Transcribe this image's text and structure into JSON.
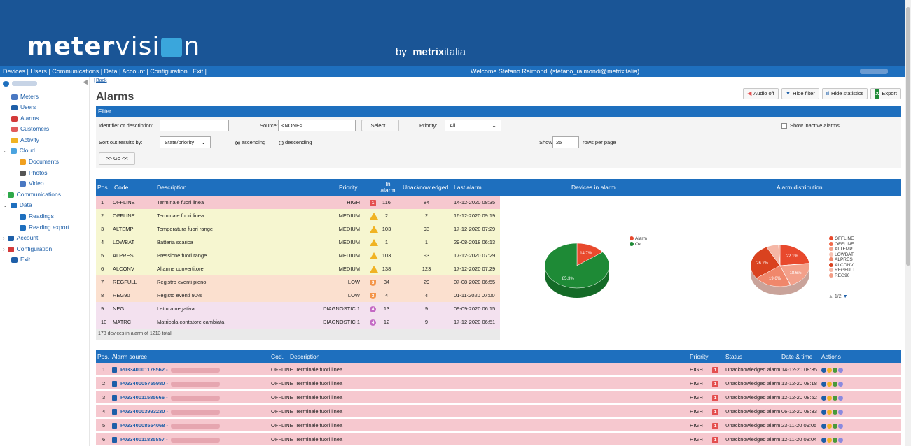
{
  "header": {
    "logo_main": "meter",
    "logo_thin": "visi",
    "logo_end": "n",
    "by_text": "by",
    "brand_bold": "metrix",
    "brand_light": "italia"
  },
  "nav": {
    "links": "Devices | Users | Communications | Data | Account | Configuration | Exit |",
    "welcome": "Welcome Stefano Raimondi (stefano_raimondi@metrixitalia)"
  },
  "sidebar": {
    "items": [
      {
        "label": "Meters",
        "color": "#4a78c2"
      },
      {
        "label": "Users",
        "color": "#1e5fa8"
      },
      {
        "label": "Alarms",
        "color": "#d33a3a"
      },
      {
        "label": "Customers",
        "color": "#e25c5c"
      },
      {
        "label": "Activity",
        "color": "#f0b323"
      },
      {
        "label": "Cloud",
        "color": "#4aa3df"
      },
      {
        "label": "Documents",
        "color": "#f0a020"
      },
      {
        "label": "Photos",
        "color": "#555"
      },
      {
        "label": "Video",
        "color": "#4a78c2"
      },
      {
        "label": "Communications",
        "color": "#2ea84a"
      },
      {
        "label": "Data",
        "color": "#1e6fbe"
      },
      {
        "label": "Readings",
        "color": "#1e6fbe"
      },
      {
        "label": "Reading export",
        "color": "#1e6fbe"
      },
      {
        "label": "Account",
        "color": "#1e5fa8"
      },
      {
        "label": "Configuration",
        "color": "#d33a3a"
      },
      {
        "label": "Exit",
        "color": "#1e5fa8"
      }
    ]
  },
  "page": {
    "back": "Back",
    "title": "Alarms",
    "buttons": {
      "audio_off": "Audio off",
      "hide_filter": "Hide filter",
      "hide_statistics": "Hide statistics",
      "export": "Export"
    }
  },
  "filter": {
    "heading": "Filter",
    "identifier_label": "Identifier or description:",
    "identifier_value": "",
    "source_label": "Source:",
    "source_value": "<NONE>",
    "select_button": "Select...",
    "priority_label": "Priority:",
    "priority_value": "All",
    "show_inactive": "Show inactive alarms",
    "sort_label": "Sort out results by:",
    "sort_value": "State/priority",
    "ascending": "ascending",
    "descending": "descending",
    "show_label": "Show",
    "rows_value": "25",
    "rows_suffix": "rows per page",
    "go_button": ">> Go <<"
  },
  "alarms_table": {
    "headers": {
      "pos": "Pos.",
      "code": "Code",
      "description": "Description",
      "priority": "Priority",
      "in_alarm_1": "In",
      "in_alarm_2": "alarm",
      "unacknowledged": "Unacknowledged",
      "last_alarm": "Last alarm",
      "devices_in_alarm": "Devices in alarm",
      "alarm_distribution": "Alarm distribution"
    },
    "rows": [
      {
        "pos": "1",
        "code": "OFFLINE",
        "desc": "Terminale fuori linea",
        "priority": "HIGH",
        "level": "high",
        "icon": "1",
        "in_alarm": "116",
        "unack": "84",
        "last": "14-12-2020 08:35",
        "bg": "#f6c8cf"
      },
      {
        "pos": "2",
        "code": "OFFLINE",
        "desc": "Terminale fuori linea",
        "priority": "MEDIUM",
        "level": "medium",
        "icon": "",
        "in_alarm": "2",
        "unack": "2",
        "last": "16-12-2020 09:19",
        "bg": "#f6f6d0"
      },
      {
        "pos": "3",
        "code": "ALTEMP",
        "desc": "Temperatura fuori range",
        "priority": "MEDIUM",
        "level": "medium",
        "icon": "",
        "in_alarm": "103",
        "unack": "93",
        "last": "17-12-2020 07:29",
        "bg": "#f6f6d0"
      },
      {
        "pos": "4",
        "code": "LOWBAT",
        "desc": "Batteria scarica",
        "priority": "MEDIUM",
        "level": "medium",
        "icon": "",
        "in_alarm": "1",
        "unack": "1",
        "last": "29-08-2018 06:13",
        "bg": "#f6f6d0"
      },
      {
        "pos": "5",
        "code": "ALPRES",
        "desc": "Pressione fuori range",
        "priority": "MEDIUM",
        "level": "medium",
        "icon": "",
        "in_alarm": "103",
        "unack": "93",
        "last": "17-12-2020 07:29",
        "bg": "#f6f6d0"
      },
      {
        "pos": "6",
        "code": "ALCONV",
        "desc": "Allarme convertitore",
        "priority": "MEDIUM",
        "level": "medium",
        "icon": "",
        "in_alarm": "138",
        "unack": "123",
        "last": "17-12-2020 07:29",
        "bg": "#f6f6d0"
      },
      {
        "pos": "7",
        "code": "REGFULL",
        "desc": "Registro eventi pieno",
        "priority": "LOW",
        "level": "low",
        "icon": "3",
        "in_alarm": "34",
        "unack": "29",
        "last": "07-08-2020 06:55",
        "bg": "#fbe0cf"
      },
      {
        "pos": "8",
        "code": "REG90",
        "desc": "Registo eventi 90%",
        "priority": "LOW",
        "level": "low",
        "icon": "3",
        "in_alarm": "4",
        "unack": "4",
        "last": "01-11-2020 07:00",
        "bg": "#fbe0cf"
      },
      {
        "pos": "9",
        "code": "NEG",
        "desc": "Lettura negativa",
        "priority": "DIAGNOSTIC 1",
        "level": "diag",
        "icon": "4",
        "in_alarm": "13",
        "unack": "9",
        "last": "09-09-2020 06:15",
        "bg": "#f3e1ef"
      },
      {
        "pos": "10",
        "code": "MATRC",
        "desc": "Matricola contatore cambiata",
        "priority": "DIAGNOSTIC 1",
        "level": "diag",
        "icon": "4",
        "in_alarm": "12",
        "unack": "9",
        "last": "17-12-2020 06:51",
        "bg": "#f3e1ef"
      }
    ],
    "footnote": "178 devices in alarm of 1213 total"
  },
  "chart_data": [
    {
      "type": "pie",
      "title": "Devices in alarm",
      "categories": [
        "Alarm",
        "Ok"
      ],
      "values": [
        14.7,
        85.3
      ],
      "colors": [
        "#e8492d",
        "#1e8a36"
      ],
      "legend": "top-right"
    },
    {
      "type": "pie",
      "title": "Alarm distribution",
      "categories": [
        "OFFLINE",
        "OFFLINE",
        "ALTEMP",
        "LOWBAT",
        "ALPRES",
        "ALCONV",
        "REGFULL",
        "REG90"
      ],
      "values": [
        22.1,
        0.4,
        19.6,
        0.2,
        19.6,
        26.2,
        6.5,
        0.8
      ],
      "labels": [
        "22.1%",
        "",
        "18.6%",
        "",
        "19.6%",
        "26.2%",
        "",
        ""
      ],
      "colors": [
        "#e8492d",
        "#f06a4c",
        "#f3a08a",
        "#f7c2b3",
        "#f0876b",
        "#d9421f",
        "#f5b7a6",
        "#f29d86"
      ],
      "legend": "right",
      "pager": "1/2"
    }
  ],
  "pie_labels": {
    "alarm_pct": "14.7%",
    "ok_pct": "85.3%",
    "d1": "22.1%",
    "d2": "26.2%",
    "d3": "18.6%",
    "d4": "19.6%"
  },
  "sources_table": {
    "headers": {
      "pos": "Pos.",
      "source": "Alarm source",
      "cod": "Cod.",
      "description": "Description",
      "priority": "Priority",
      "status": "Status",
      "datetime": "Date & time",
      "actions": "Actions"
    },
    "rows": [
      {
        "pos": "1",
        "source": "P03340001178562 -",
        "cod": "OFFLINE",
        "desc": "Terminale fuori linea",
        "priority": "HIGH",
        "status": "Unacknowledged alarm",
        "datetime": "14-12-20 08:35"
      },
      {
        "pos": "2",
        "source": "P03340005755980 -",
        "cod": "OFFLINE",
        "desc": "Terminale fuori linea",
        "priority": "HIGH",
        "status": "Unacknowledged alarm",
        "datetime": "13-12-20 08:18"
      },
      {
        "pos": "3",
        "source": "P03340011585666 -",
        "cod": "OFFLINE",
        "desc": "Terminale fuori linea",
        "priority": "HIGH",
        "status": "Unacknowledged alarm",
        "datetime": "12-12-20 08:52"
      },
      {
        "pos": "4",
        "source": "P03340003993230 -",
        "cod": "OFFLINE",
        "desc": "Terminale fuori linea",
        "priority": "HIGH",
        "status": "Unacknowledged alarm",
        "datetime": "06-12-20 08:33"
      },
      {
        "pos": "5",
        "source": "P03340008554068 -",
        "cod": "OFFLINE",
        "desc": "Terminale fuori linea",
        "priority": "HIGH",
        "status": "Unacknowledged alarm",
        "datetime": "23-11-20 09:05"
      },
      {
        "pos": "6",
        "source": "P03340011835857 -",
        "cod": "OFFLINE",
        "desc": "Terminale fuori linea",
        "priority": "HIGH",
        "status": "Unacknowledged alarm",
        "datetime": "12-11-20 08:04"
      }
    ]
  }
}
